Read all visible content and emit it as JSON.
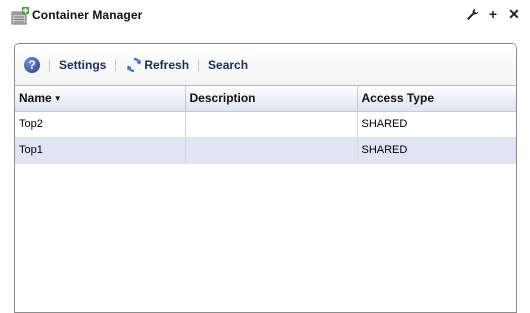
{
  "window": {
    "title": "Container Manager",
    "app_icon": "container-manager-icon",
    "controls": [
      {
        "name": "wrench-icon",
        "glyph": "🔧"
      },
      {
        "name": "add-icon",
        "glyph": "+"
      },
      {
        "name": "close-icon",
        "glyph": "✕"
      }
    ]
  },
  "toolbar": {
    "help_glyph": "?",
    "settings_label": "Settings",
    "refresh_label": "Refresh",
    "search_label": "Search"
  },
  "table": {
    "columns": [
      "Name",
      "Description",
      "Access Type"
    ],
    "sort_indicator": "▼",
    "rows": [
      {
        "name": "Top2",
        "description": "",
        "access_type": "SHARED"
      },
      {
        "name": "Top1",
        "description": "",
        "access_type": "SHARED"
      }
    ]
  },
  "colors": {
    "accent": "#14305e",
    "row_alt": "#e1e4f4",
    "border": "#8d8d8d"
  }
}
